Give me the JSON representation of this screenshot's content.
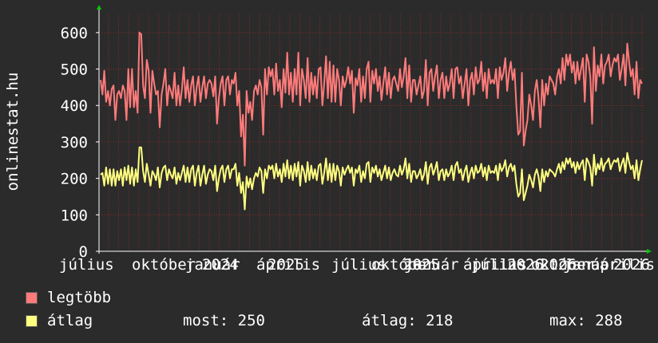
{
  "chart_data": {
    "type": "line",
    "ylabel": "onlinestat.hu",
    "ylim": [
      0,
      650
    ],
    "yticks": [
      0,
      100,
      200,
      300,
      400,
      500,
      600
    ],
    "grid": true,
    "x_tick_labels": [
      "július",
      "október",
      "2024",
      "január",
      "április",
      "2025",
      "július",
      "október",
      "2025",
      "január",
      "április",
      "2026",
      "július",
      "október",
      "2026",
      "január",
      "április",
      "2026"
    ],
    "series": [
      {
        "name": "legtöbb",
        "color": "#ff7b7b",
        "values": [
          470,
          430,
          495,
          410,
          440,
          400,
          445,
          455,
          360,
          430,
          440,
          420,
          455,
          440,
          360,
          500,
          395,
          500,
          395,
          440,
          380,
          600,
          595,
          455,
          420,
          525,
          495,
          380,
          495,
          460,
          430,
          440,
          340,
          430,
          460,
          500,
          400,
          455,
          440,
          420,
          490,
          400,
          455,
          400,
          445,
          505,
          420,
          470,
          410,
          455,
          480,
          400,
          450,
          480,
          410,
          450,
          480,
          420,
          460,
          470,
          460,
          425,
          480,
          350,
          420,
          460,
          480,
          400,
          470,
          480,
          430,
          470,
          460,
          490,
          400,
          440,
          315,
          375,
          235,
          440,
          380,
          410,
          360,
          440,
          455,
          430,
          470,
          450,
          320,
          500,
          430,
          505,
          480,
          500,
          430,
          515,
          440,
          470,
          395,
          500,
          435,
          545,
          430,
          490,
          410,
          500,
          430,
          545,
          400,
          500,
          470,
          420,
          530,
          410,
          490,
          430,
          480,
          420,
          500,
          505,
          400,
          460,
          535,
          420,
          520,
          410,
          510,
          410,
          500,
          470,
          400,
          480,
          450,
          470,
          505,
          460,
          495,
          380,
          475,
          455,
          500,
          410,
          480,
          420,
          500,
          520,
          410,
          495,
          460,
          500,
          440,
          480,
          415,
          460,
          505,
          430,
          490,
          420,
          470,
          480,
          460,
          440,
          500,
          450,
          480,
          530,
          420,
          510,
          410,
          470,
          470,
          430,
          455,
          480,
          420,
          440,
          525,
          400,
          490,
          500,
          440,
          480,
          510,
          420,
          470,
          490,
          420,
          480,
          440,
          460,
          500,
          420,
          500,
          505,
          460,
          480,
          420,
          460,
          500,
          400,
          470,
          490,
          430,
          505,
          460,
          470,
          520,
          440,
          490,
          420,
          500,
          460,
          470,
          460,
          500,
          420,
          505,
          470,
          490,
          530,
          440,
          490,
          520,
          470,
          500,
          400,
          320,
          330,
          490,
          290,
          330,
          360,
          430,
          400,
          360,
          440,
          470,
          420,
          340,
          470,
          400,
          460,
          430,
          480,
          470,
          460,
          430,
          480,
          500,
          460,
          530,
          470,
          540,
          510,
          540,
          490,
          520,
          460,
          520,
          470,
          500,
          530,
          410,
          540,
          520,
          480,
          350,
          560,
          440,
          510,
          480,
          540,
          460,
          510,
          520,
          540,
          480,
          510,
          530,
          520,
          540,
          470,
          500,
          540,
          455,
          570,
          520,
          480,
          500,
          430,
          520,
          420,
          470,
          460
        ],
        "summary": null
      },
      {
        "name": "átlag",
        "color": "#ffff80",
        "values": [
          210,
          215,
          180,
          230,
          185,
          225,
          180,
          225,
          180,
          220,
          195,
          225,
          180,
          230,
          195,
          235,
          185,
          230,
          180,
          225,
          190,
          285,
          285,
          220,
          190,
          240,
          210,
          180,
          220,
          210,
          195,
          230,
          175,
          215,
          230,
          235,
          195,
          225,
          210,
          200,
          230,
          185,
          215,
          195,
          215,
          235,
          190,
          230,
          190,
          225,
          235,
          180,
          215,
          235,
          180,
          210,
          235,
          185,
          210,
          225,
          220,
          195,
          235,
          165,
          200,
          225,
          235,
          190,
          225,
          235,
          200,
          225,
          225,
          240,
          180,
          215,
          160,
          190,
          115,
          205,
          175,
          200,
          170,
          200,
          215,
          205,
          230,
          220,
          160,
          225,
          200,
          235,
          225,
          235,
          200,
          240,
          205,
          225,
          190,
          240,
          205,
          250,
          200,
          235,
          195,
          240,
          205,
          245,
          180,
          235,
          220,
          190,
          245,
          195,
          235,
          200,
          225,
          195,
          235,
          240,
          185,
          215,
          255,
          195,
          240,
          190,
          240,
          195,
          235,
          220,
          180,
          230,
          210,
          225,
          235,
          215,
          230,
          180,
          225,
          215,
          235,
          190,
          220,
          200,
          240,
          245,
          190,
          230,
          215,
          235,
          205,
          225,
          195,
          215,
          235,
          200,
          230,
          195,
          215,
          225,
          210,
          205,
          235,
          210,
          225,
          255,
          200,
          240,
          190,
          220,
          220,
          200,
          210,
          225,
          195,
          210,
          245,
          185,
          230,
          240,
          210,
          225,
          245,
          195,
          220,
          225,
          195,
          225,
          205,
          215,
          235,
          195,
          235,
          245,
          215,
          225,
          195,
          220,
          235,
          190,
          215,
          230,
          200,
          235,
          215,
          220,
          240,
          205,
          230,
          195,
          235,
          215,
          220,
          215,
          235,
          195,
          240,
          220,
          230,
          250,
          205,
          230,
          240,
          220,
          235,
          185,
          150,
          160,
          225,
          140,
          160,
          180,
          210,
          195,
          175,
          210,
          225,
          205,
          165,
          225,
          190,
          220,
          205,
          225,
          220,
          215,
          205,
          225,
          240,
          215,
          245,
          225,
          255,
          240,
          255,
          230,
          245,
          215,
          245,
          225,
          240,
          250,
          195,
          255,
          245,
          230,
          180,
          265,
          210,
          240,
          225,
          255,
          220,
          240,
          245,
          255,
          225,
          240,
          250,
          245,
          255,
          220,
          240,
          255,
          215,
          270,
          245,
          225,
          235,
          200,
          250,
          195,
          225,
          250
        ]
      }
    ]
  },
  "legend": {
    "legtobb_label": "legtöbb",
    "atlag_label": "átlag"
  },
  "stats": {
    "most_label": "most:",
    "most_value": "250",
    "atlag_label": "átlag:",
    "atlag_value": "218",
    "max_label": "max:",
    "max_value": "288"
  },
  "colors": {
    "background": "#2b2b2b",
    "plot_background": "#2b2b2b",
    "grid": "#8b2a2a",
    "axis": "#ffffff",
    "arrow": "#00cc00"
  }
}
